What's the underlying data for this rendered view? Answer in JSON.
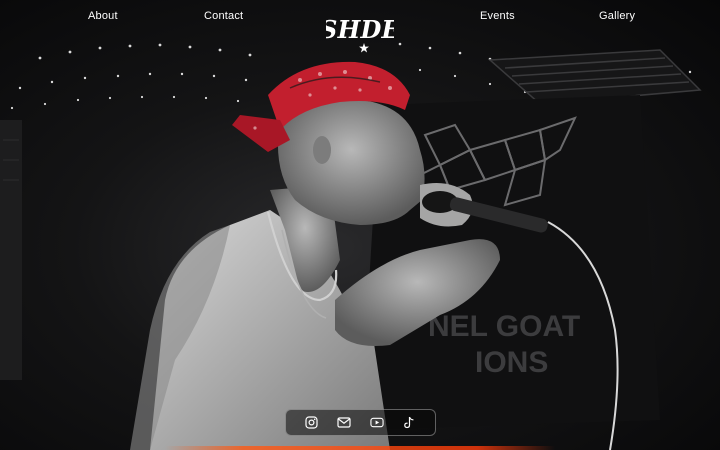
{
  "nav": {
    "about": "About",
    "contact": "Contact",
    "events": "Events",
    "gallery": "Gallery"
  },
  "logo": {
    "text": "SHDE"
  },
  "banner": {
    "line1": "NEL GOAT",
    "line2": "IONS"
  },
  "social": [
    {
      "icon": "instagram-icon"
    },
    {
      "icon": "mail-icon"
    },
    {
      "icon": "youtube-icon"
    },
    {
      "icon": "tiktok-icon"
    }
  ],
  "colors": {
    "background": "#0b0b0c",
    "bandana": "#c21f2e",
    "accent": "#ff5a14"
  }
}
